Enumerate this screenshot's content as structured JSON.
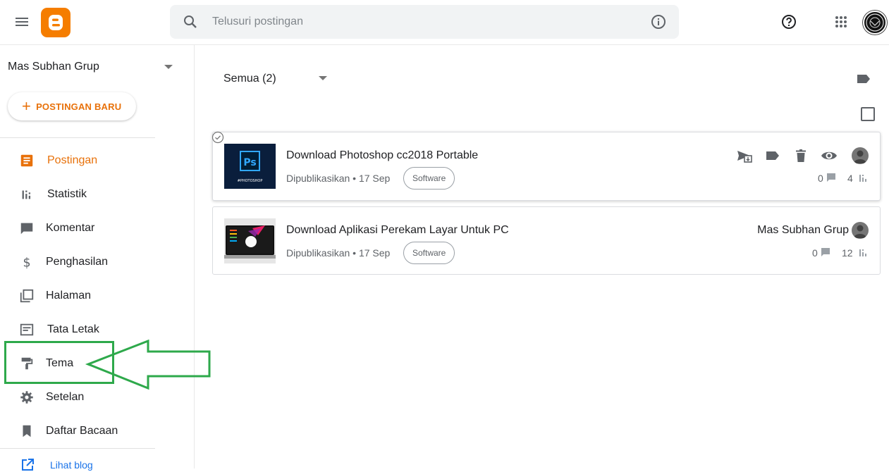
{
  "header": {
    "search_placeholder": "Telusuri postingan"
  },
  "sidebar": {
    "blog_name": "Mas Subhan Grup",
    "new_post_label": "POSTINGAN BARU",
    "items": [
      {
        "label": "Postingan",
        "icon": "posts-icon",
        "active": true
      },
      {
        "label": "Statistik",
        "icon": "stats-icon"
      },
      {
        "label": "Komentar",
        "icon": "comment-icon"
      },
      {
        "label": "Penghasilan",
        "icon": "dollar-icon"
      },
      {
        "label": "Halaman",
        "icon": "pages-icon"
      },
      {
        "label": "Tata Letak",
        "icon": "layout-icon"
      },
      {
        "label": "Tema",
        "icon": "paint-roller-icon"
      },
      {
        "label": "Setelan",
        "icon": "gear-icon"
      },
      {
        "label": "Daftar Bacaan",
        "icon": "bookmark-icon"
      }
    ],
    "view_blog_label": "Lihat blog"
  },
  "main": {
    "filter_label": "Semua (2)",
    "posts": [
      {
        "title": "Download Photoshop cc2018 Portable",
        "meta": "Dipublikasikan • 17 Sep",
        "label": "Software",
        "comments": "0",
        "views": "4",
        "thumb_text": "Ps",
        "thumb_caption": "#PHOTOSHOP"
      },
      {
        "title": "Download Aplikasi Perekam Layar Untuk PC",
        "meta": "Dipublikasikan • 17 Sep",
        "label": "Software",
        "author": "Mas Subhan Grup",
        "comments": "0",
        "views": "12"
      }
    ]
  },
  "colors": {
    "accent": "#e8710a",
    "blogger_orange": "#f57d00",
    "highlight_green": "#2ea94b",
    "link_blue": "#1a73e8"
  }
}
